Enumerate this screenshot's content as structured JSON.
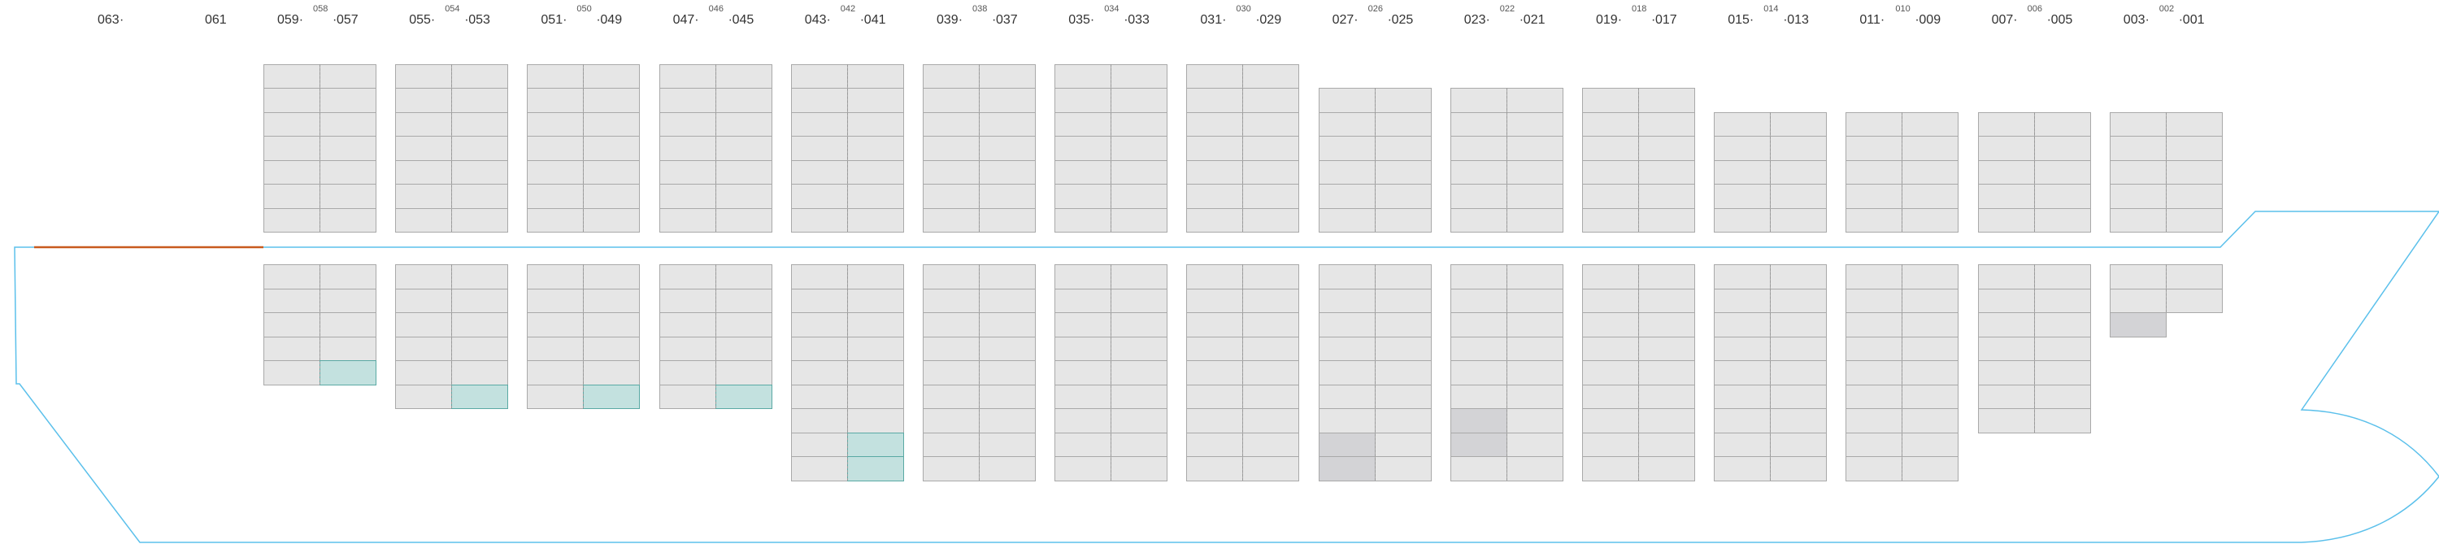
{
  "colors": {
    "hull": "#5bc0eb",
    "deck_segment": "#c85a1e",
    "empty_cell": "#e6e6e6",
    "occupied_cell": "#d3d3d6",
    "reefer_cell": "#c3e1df",
    "reefer_border": "#5aa9a4",
    "cell_border": "#a9a9a9",
    "bay_centerline": "#9a9a9a"
  },
  "bays": [
    {
      "id": "b63",
      "left": "063",
      "right": "",
      "center": "",
      "deck_rows": 0,
      "hold_rows": 0
    },
    {
      "id": "b61",
      "left": "",
      "right": "061",
      "center": "",
      "deck_rows": 0,
      "hold_rows": 0
    },
    {
      "id": "b57",
      "left": "059",
      "right": "057",
      "center": "058",
      "deck_rows": 7,
      "hold_rows": 5,
      "cells": [
        {
          "part": "hold",
          "side": "R",
          "row": 4,
          "state": "reefer"
        }
      ]
    },
    {
      "id": "b53",
      "left": "055",
      "right": "053",
      "center": "054",
      "deck_rows": 7,
      "hold_rows": 6,
      "cells": [
        {
          "part": "hold",
          "side": "R",
          "row": 5,
          "state": "reefer"
        }
      ]
    },
    {
      "id": "b49",
      "left": "051",
      "right": "049",
      "center": "050",
      "deck_rows": 7,
      "hold_rows": 6,
      "cells": [
        {
          "part": "hold",
          "side": "R",
          "row": 5,
          "state": "reefer"
        }
      ]
    },
    {
      "id": "b45",
      "left": "047",
      "right": "045",
      "center": "046",
      "deck_rows": 7,
      "hold_rows": 6,
      "cells": [
        {
          "part": "hold",
          "side": "R",
          "row": 5,
          "state": "reefer"
        }
      ]
    },
    {
      "id": "b41",
      "left": "043",
      "right": "041",
      "center": "042",
      "deck_rows": 7,
      "hold_rows": 9,
      "cells": [
        {
          "part": "hold",
          "side": "R",
          "row": 7,
          "state": "reefer"
        },
        {
          "part": "hold",
          "side": "R",
          "row": 8,
          "state": "reefer"
        }
      ]
    },
    {
      "id": "b37",
      "left": "039",
      "right": "037",
      "center": "038",
      "deck_rows": 7,
      "hold_rows": 9
    },
    {
      "id": "b33",
      "left": "035",
      "right": "033",
      "center": "034",
      "deck_rows": 7,
      "hold_rows": 9
    },
    {
      "id": "b29",
      "left": "031",
      "right": "029",
      "center": "030",
      "deck_rows": 7,
      "hold_rows": 9
    },
    {
      "id": "b25",
      "left": "027",
      "right": "025",
      "center": "026",
      "deck_rows": 6,
      "hold_rows": 9,
      "cells": [
        {
          "part": "hold",
          "side": "L",
          "row": 7,
          "state": "occupied"
        },
        {
          "part": "hold",
          "side": "L",
          "row": 8,
          "state": "occupied"
        }
      ]
    },
    {
      "id": "b21",
      "left": "023",
      "right": "021",
      "center": "022",
      "deck_rows": 6,
      "hold_rows": 9,
      "cells": [
        {
          "part": "hold",
          "side": "L",
          "row": 6,
          "state": "occupied"
        },
        {
          "part": "hold",
          "side": "L",
          "row": 7,
          "state": "occupied"
        }
      ]
    },
    {
      "id": "b17",
      "left": "019",
      "right": "017",
      "center": "018",
      "deck_rows": 6,
      "hold_rows": 9
    },
    {
      "id": "b13",
      "left": "015",
      "right": "013",
      "center": "014",
      "deck_rows": 5,
      "hold_rows": 9
    },
    {
      "id": "b09",
      "left": "011",
      "right": "009",
      "center": "010",
      "deck_rows": 5,
      "hold_rows": 9
    },
    {
      "id": "b05",
      "left": "007",
      "right": "005",
      "center": "006",
      "deck_rows": 5,
      "hold_rows": 7
    },
    {
      "id": "b01",
      "left": "003",
      "right": "001",
      "center": "002",
      "deck_rows": 5,
      "hold_rows": 3,
      "hold_row_sides": [
        "LR",
        "LR",
        "L"
      ],
      "cells": [
        {
          "part": "hold",
          "side": "L",
          "row": 2,
          "state": "occupied"
        }
      ]
    }
  ]
}
